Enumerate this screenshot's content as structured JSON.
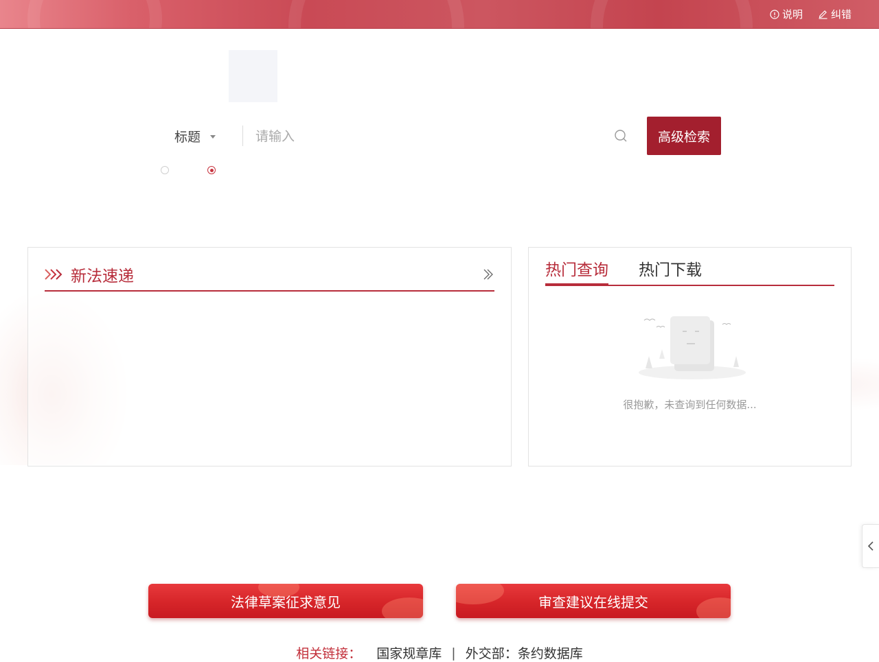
{
  "topbar": {
    "links": [
      {
        "icon": "info-icon",
        "label": "说明"
      },
      {
        "icon": "edit-icon",
        "label": "纠错"
      }
    ]
  },
  "search": {
    "field_label": "标题",
    "placeholder": "请输入",
    "advanced_label": "高级检索"
  },
  "new_laws": {
    "title": "新法速递"
  },
  "hot": {
    "tabs": [
      "热门查询",
      "热门下载"
    ],
    "active_tab": 0,
    "empty_message": "很抱歉，未查询到任何数据..."
  },
  "actions": {
    "draft_label": "法律草案征求意见",
    "review_label": "审查建议在线提交"
  },
  "related": {
    "label": "相关链接：",
    "links": [
      "国家规章库",
      "外交部：条约数据库"
    ]
  },
  "colors": {
    "accent": "#b72c3a",
    "button_dark": "#a31f2e",
    "action_red": "#d62529"
  }
}
